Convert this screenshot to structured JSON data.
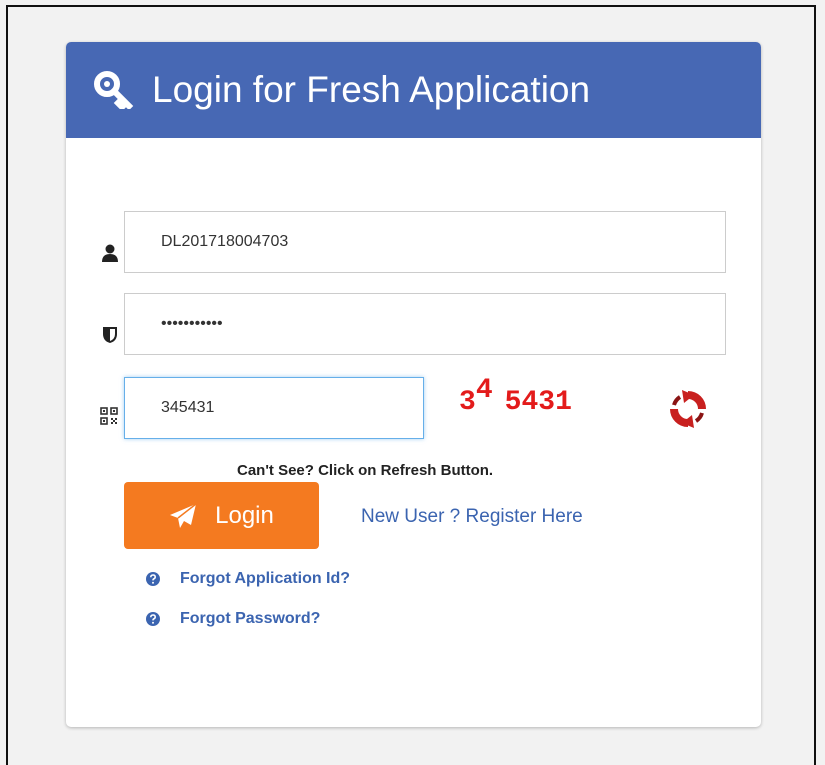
{
  "header": {
    "title": "Login for Fresh Application",
    "icon": "key-icon"
  },
  "form": {
    "application_id": {
      "value": "DL201718004703",
      "icon": "user-icon"
    },
    "password": {
      "value": "password123",
      "icon": "shield-icon"
    },
    "captcha_input": {
      "value": "345431",
      "icon": "qr-code-icon"
    },
    "captcha_image": {
      "chars": [
        "3",
        "4",
        "5",
        "4",
        "3",
        "1"
      ],
      "color": "#e31b1b"
    },
    "captcha_hint": "Can't See? Click on Refresh Button.",
    "login_label": "Login",
    "register_label": "New User ? Register Here"
  },
  "links": {
    "forgot_application_id": "Forgot Application Id?",
    "forgot_password": "Forgot Password?"
  },
  "colors": {
    "header_bg": "#4768b4",
    "login_button": "#f47a20",
    "link": "#3b64b0",
    "refresh_icon": "#c8201f"
  }
}
